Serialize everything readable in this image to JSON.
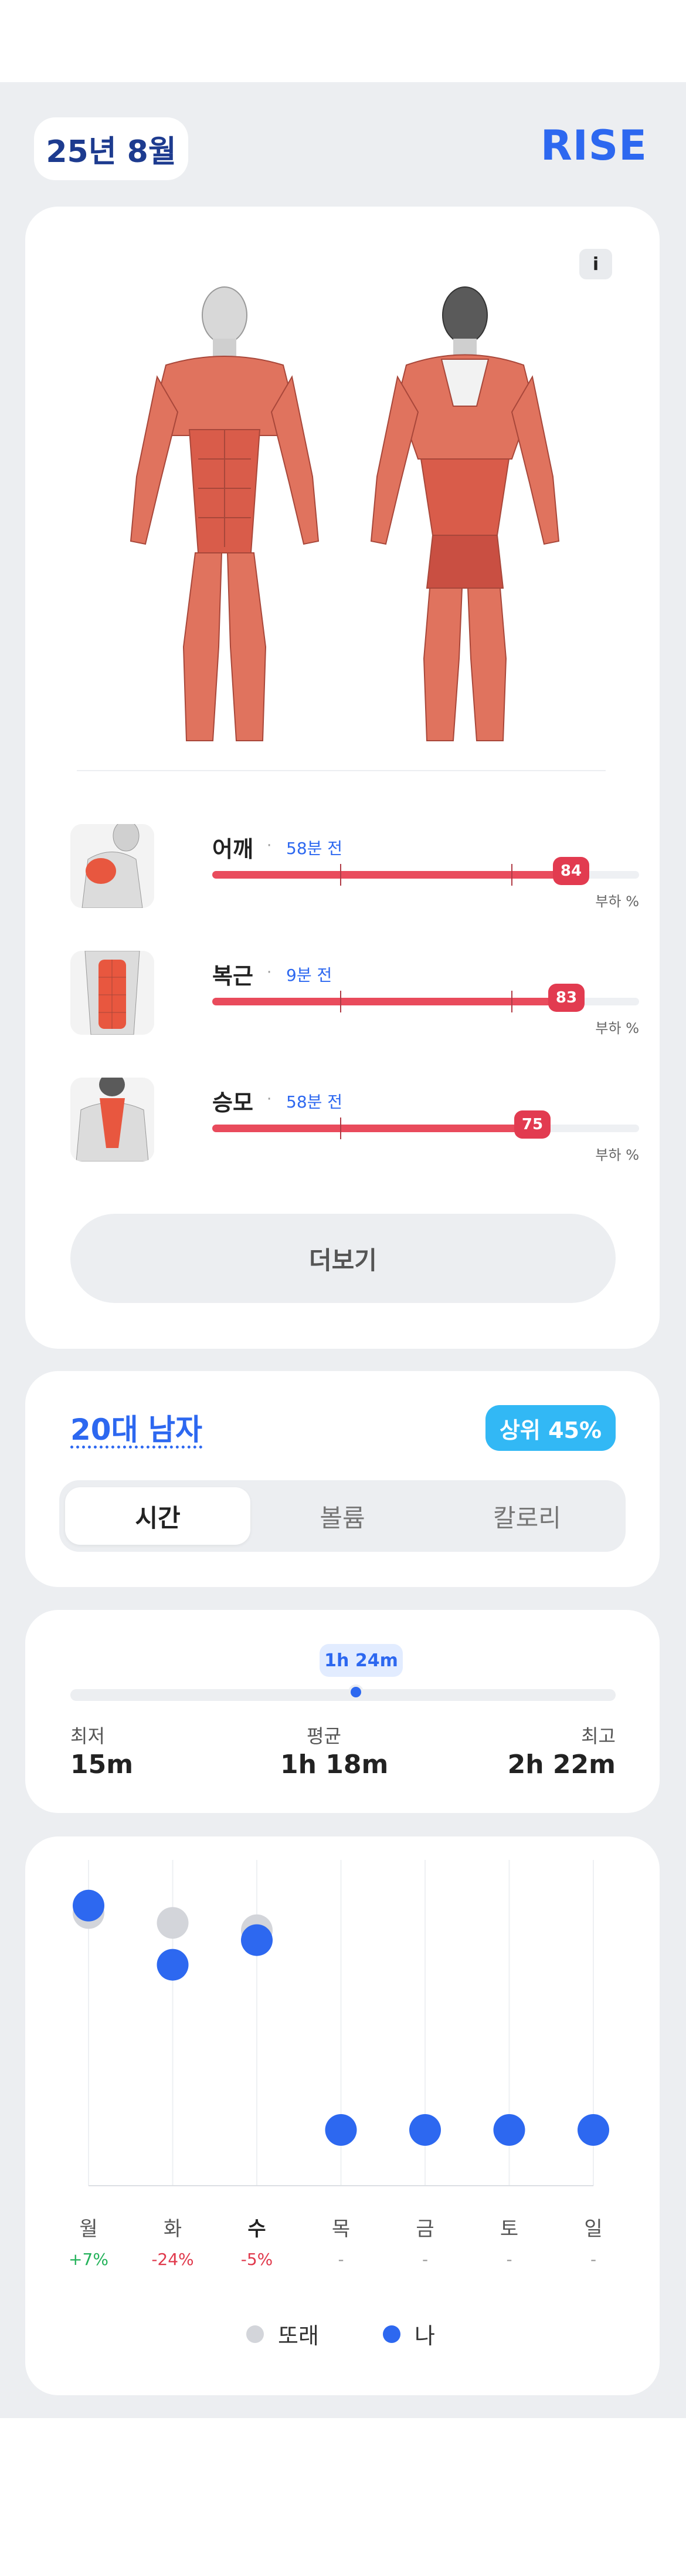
{
  "header": {
    "date": "25년 8월",
    "brand": "RISE"
  },
  "info_button": {
    "label": "i"
  },
  "muscles": [
    {
      "name": "어깨",
      "separator": "·",
      "time": "58분 전",
      "load": 84,
      "unit": "부하 %"
    },
    {
      "name": "복근",
      "separator": "·",
      "time": "9분 전",
      "load": 83,
      "unit": "부하 %"
    },
    {
      "name": "승모",
      "separator": "·",
      "time": "58분 전",
      "load": 75,
      "unit": "부하 %"
    }
  ],
  "more_button": "더보기",
  "group": {
    "label": "20대 남자",
    "rank": "상위 45%"
  },
  "tabs": [
    {
      "label": "시간",
      "active": true
    },
    {
      "label": "볼륨",
      "active": false
    },
    {
      "label": "칼로리",
      "active": false
    }
  ],
  "range": {
    "my_value": "1h 24m",
    "min_label": "최저",
    "min_value": "15m",
    "avg_label": "평균",
    "avg_value": "1h 18m",
    "max_label": "최고",
    "max_value": "2h 22m"
  },
  "colors": {
    "accent": "#2d68f0",
    "load_bar": "#e94b5c",
    "badge": "#e23b50",
    "rank_badge": "#32b8f5",
    "peer": "#d3d5da",
    "positive": "#23b25a",
    "negative": "#e0394c"
  },
  "chart_data": {
    "type": "scatter",
    "categories": [
      "월",
      "화",
      "수",
      "목",
      "금",
      "토",
      "일"
    ],
    "today": "수",
    "changes": [
      "+7%",
      "-24%",
      "-5%",
      "-",
      "-",
      "-",
      "-"
    ],
    "series": [
      {
        "name": "또래",
        "color": "#d3d5da",
        "values": [
          0.88,
          0.84,
          0.81,
          null,
          null,
          null,
          null
        ]
      },
      {
        "name": "나",
        "color": "#2d68f0",
        "values": [
          0.91,
          0.67,
          0.77,
          0,
          0,
          0,
          0
        ]
      }
    ],
    "ylim": [
      0,
      1
    ],
    "grid": true
  }
}
